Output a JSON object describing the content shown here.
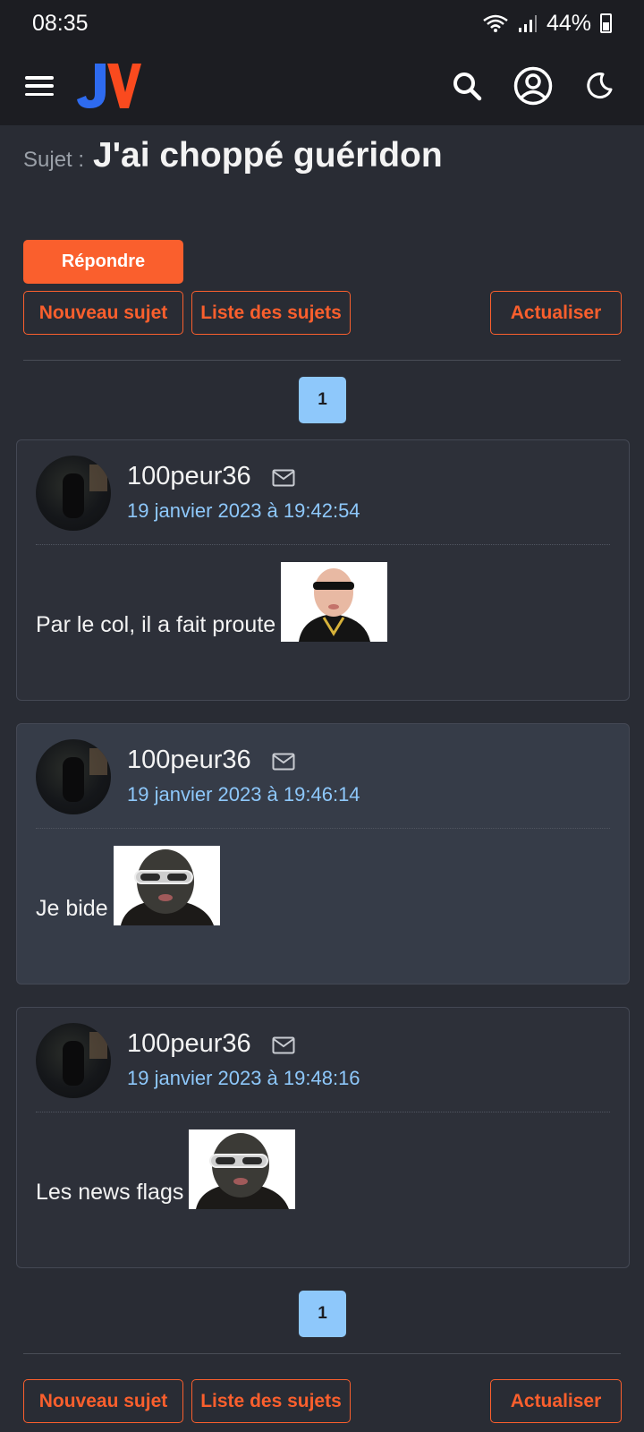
{
  "status_bar": {
    "time": "08:35",
    "battery": "44%"
  },
  "header": {
    "logo_text": "JV"
  },
  "topic": {
    "label": "Sujet :",
    "title": "J'ai choppé guéridon"
  },
  "actions": {
    "reply": "Répondre",
    "new_topic": "Nouveau sujet",
    "topic_list": "Liste des sujets",
    "refresh": "Actualiser"
  },
  "pagination": {
    "current_page": "1"
  },
  "posts": [
    {
      "author": "100peur36",
      "date": "19 janvier 2023 à 19:42:54",
      "text": "Par le col, il a fait proute"
    },
    {
      "author": "100peur36",
      "date": "19 janvier 2023 à 19:46:14",
      "text": "Je bide"
    },
    {
      "author": "100peur36",
      "date": "19 janvier 2023 à 19:48:16",
      "text": "Les news flags"
    }
  ],
  "colors": {
    "accent": "#fa5f2d",
    "link_blue": "#8ec8fb",
    "background": "#292c34"
  }
}
